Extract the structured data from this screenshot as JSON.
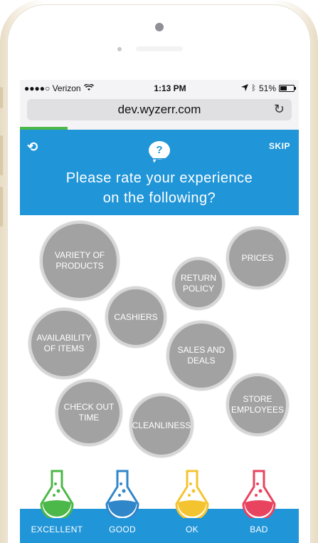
{
  "status": {
    "carrier": "●●●●○ Verizon",
    "time": "1:13 PM",
    "battery": "51%",
    "battery_level": 0.51
  },
  "browser": {
    "url": "dev.wyzerr.com",
    "page_progress": 0.17
  },
  "header": {
    "skip_label": "SKIP",
    "chat_glyph": "?",
    "title_line1": "Please rate your experience",
    "title_line2": "on the following?"
  },
  "topics": [
    {
      "label": "VARIETY OF PRODUCTS"
    },
    {
      "label": "PRICES"
    },
    {
      "label": "RETURN POLICY"
    },
    {
      "label": "CASHIERS"
    },
    {
      "label": "AVAILABILITY OF ITEMS"
    },
    {
      "label": "SALES AND DEALS"
    },
    {
      "label": "CHECK OUT TIME"
    },
    {
      "label": "STORE EMPLOYEES"
    },
    {
      "label": "CLEANLINESS"
    }
  ],
  "ratings": [
    {
      "label": "EXCELLENT",
      "color": "#4cb849"
    },
    {
      "label": "GOOD",
      "color": "#2f86c9"
    },
    {
      "label": "OK",
      "color": "#f4c430"
    },
    {
      "label": "BAD",
      "color": "#e8445f"
    }
  ],
  "colors": {
    "accent": "#2095d8",
    "bubble": "#a2a2a2",
    "progress": "#4cb849"
  }
}
